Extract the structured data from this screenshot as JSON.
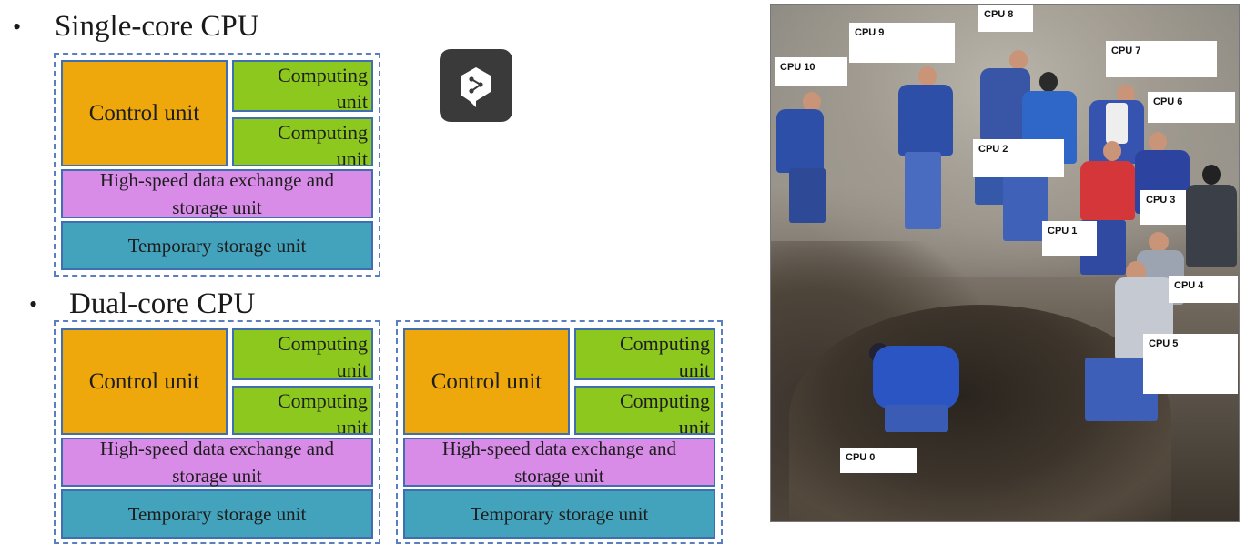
{
  "single_core": {
    "bullet": "•",
    "title": "Single-core CPU",
    "control_label": "Control unit",
    "computing_1": "Computing\nunit",
    "computing_2": "Computing\nunit",
    "highspeed": "High-speed data exchange and\nstorage unit",
    "temporary": "Temporary storage unit"
  },
  "dual_core": {
    "bullet": "•",
    "title": "Dual-core CPU",
    "cores": [
      {
        "control_label": "Control unit",
        "computing_1": "Computing\nunit",
        "computing_2": "Computing\nunit",
        "highspeed": "High-speed data exchange and\nstorage unit",
        "temporary": "Temporary storage unit"
      },
      {
        "control_label": "Control unit",
        "computing_1": "Computing\nunit",
        "computing_2": "Computing\nunit",
        "highspeed": "High-speed data exchange and\nstorage unit",
        "temporary": "Temporary storage unit"
      }
    ]
  },
  "app_icon": "share-logo-icon",
  "photo": {
    "labels": [
      "CPU 8",
      "CPU 9",
      "CPU 7",
      "CPU 10",
      "CPU 6",
      "CPU 2",
      "CPU 3",
      "CPU 1",
      "CPU 4",
      "CPU 5",
      "CPU 0"
    ]
  },
  "colors": {
    "control": "#eea80c",
    "computing": "#8cc81e",
    "highspeed": "#d88ce8",
    "temporary": "#43a3bc",
    "frame": "#5a7fc0"
  }
}
